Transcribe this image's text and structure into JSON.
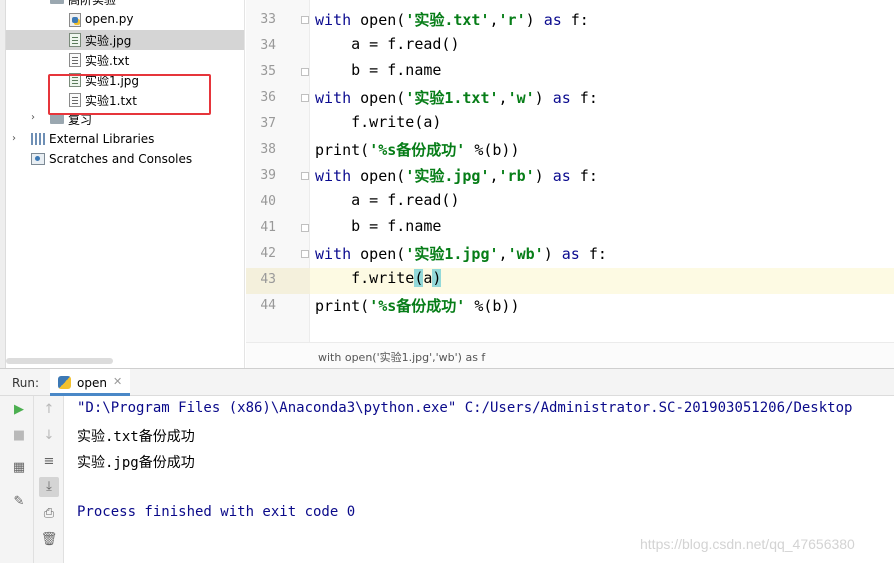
{
  "project_tree": {
    "items": [
      {
        "label": "高阶实验",
        "kind": "folder",
        "partial": true
      },
      {
        "label": "open.py",
        "kind": "python"
      },
      {
        "label": "实验.jpg",
        "kind": "image",
        "selected": true
      },
      {
        "label": "实验.txt",
        "kind": "text"
      },
      {
        "label": "实验1.jpg",
        "kind": "image"
      },
      {
        "label": "实验1.txt",
        "kind": "text"
      },
      {
        "label": "复习",
        "kind": "folder",
        "partial": true
      },
      {
        "label": "External Libraries",
        "kind": "library"
      },
      {
        "label": "Scratches and Consoles",
        "kind": "scratch"
      }
    ]
  },
  "editor": {
    "line_numbers": [
      "33",
      "34",
      "35",
      "36",
      "37",
      "38",
      "39",
      "40",
      "41",
      "42",
      "43",
      "44"
    ],
    "current_line": "43",
    "breadcrumb": "with open('实验1.jpg','wb') as f"
  },
  "run": {
    "label": "Run:",
    "tab_label": "open",
    "console": [
      "\"D:\\Program Files (x86)\\Anaconda3\\python.exe\" C:/Users/Administrator.SC-201903051206/Desktop",
      "实验.txt备份成功",
      "实验.jpg备份成功",
      "",
      "Process finished with exit code 0"
    ]
  },
  "watermark": "https://blog.csdn.net/qq_47656380",
  "colors": {
    "keyword": "#0b0b8f",
    "string": "#067d17",
    "highlight_box": "#e6353b",
    "current_line": "#fdfae3"
  },
  "icons": {
    "run": "play-icon",
    "stop": "stop-icon",
    "up": "arrow-up-icon",
    "down": "arrow-down-icon",
    "wrap": "soft-wrap-icon",
    "scroll": "scroll-to-end-icon",
    "print": "print-icon",
    "trash": "trash-icon",
    "layout": "layout-icon",
    "pin": "pin-icon"
  }
}
